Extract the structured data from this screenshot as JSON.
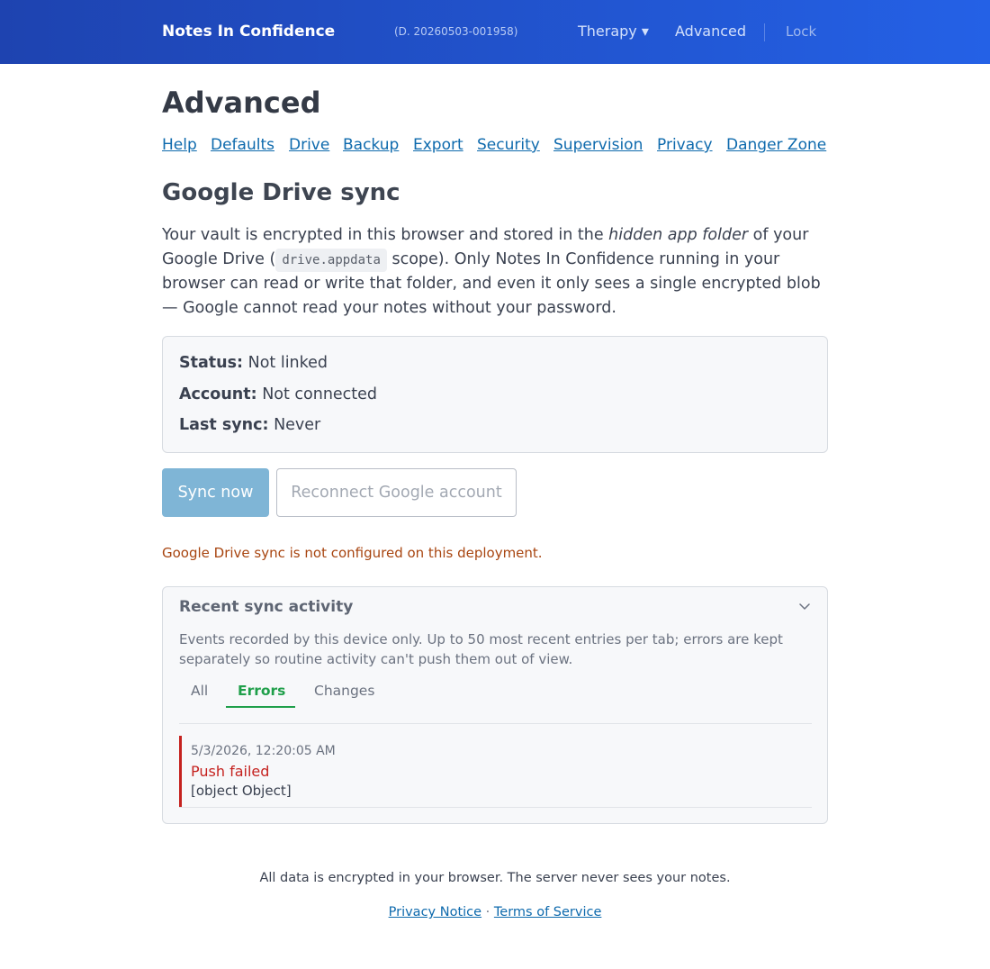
{
  "header": {
    "brand": "Notes In Confidence",
    "build": "(D. 20260503-001958)",
    "nav": {
      "therapy": "Therapy ▾",
      "advanced": "Advanced",
      "lock": "Lock"
    }
  },
  "page": {
    "title": "Advanced",
    "subnav": [
      "Help",
      "Defaults",
      "Drive",
      "Backup",
      "Export",
      "Security",
      "Supervision",
      "Privacy",
      "Danger Zone"
    ]
  },
  "drive": {
    "title": "Google Drive sync",
    "intro": {
      "l1_a": "Your vault is encrypted in this browser and stored in the ",
      "l1_em": "hidden app folder",
      "l1_b": " of your",
      "l2_a": "Google Drive (",
      "l2_code": "drive.appdata",
      "l2_b": " scope). Only Notes In Confidence running in your",
      "l3": "browser can read or write that folder, and even it only sees a single encrypted blob",
      "l4": "— Google cannot read your notes without your password."
    },
    "status": {
      "status_label": "Status:",
      "status_value": "Not linked",
      "account_label": "Account:",
      "account_value": "Not connected",
      "last_sync_label": "Last sync:",
      "last_sync_value": "Never"
    },
    "buttons": {
      "sync_now": "Sync now",
      "reconnect": "Reconnect Google account"
    },
    "warning": "Google Drive sync is not configured on this deployment."
  },
  "activity": {
    "title": "Recent sync activity",
    "description": "Events recorded by this device only. Up to 50 most recent entries per tab; errors are kept separately so routine activity can't push them out of view.",
    "tabs": [
      "All",
      "Errors",
      "Changes"
    ],
    "active_tab": "Errors",
    "entries": [
      {
        "time": "5/3/2026, 12:20:05 AM",
        "title": "Push failed",
        "detail": "[object Object]"
      }
    ]
  },
  "footer": {
    "text": "All data is encrypted in your browser. The server never sees your notes.",
    "privacy": "Privacy Notice",
    "separator": "·",
    "terms": "Terms of Service"
  },
  "colors": {
    "header_start": "#1e43b0",
    "header_end": "#2461e6",
    "link": "#0e6aad",
    "active_tab": "#1f9f4a",
    "error": "#c5221f",
    "warning": "#a84510",
    "sync_button": "#7fb5d6"
  },
  "icons": {
    "collapse": "chevron-down-icon"
  }
}
